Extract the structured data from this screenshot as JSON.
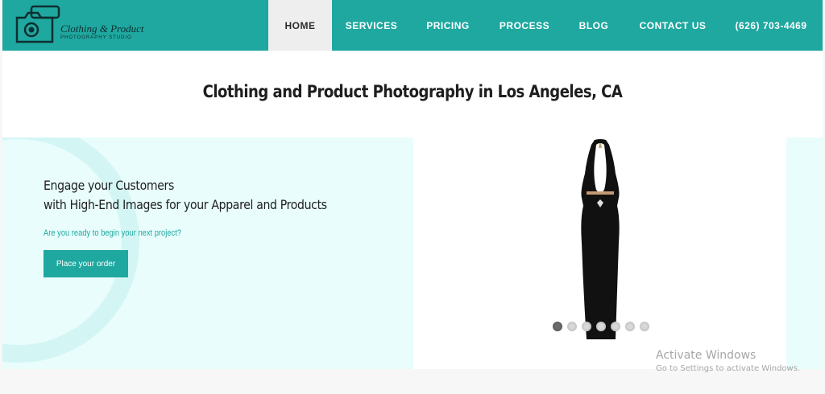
{
  "header": {
    "logo": {
      "title": "Clothing & Product",
      "subtitle": "Photography studio"
    },
    "nav": [
      {
        "label": "HOME",
        "active": true
      },
      {
        "label": "SERVICES",
        "active": false
      },
      {
        "label": "PRICING",
        "active": false
      },
      {
        "label": "PROCESS",
        "active": false
      },
      {
        "label": "BLOG",
        "active": false
      },
      {
        "label": "CONTACT US",
        "active": false
      },
      {
        "label": "(626) 703-4469",
        "active": false
      }
    ]
  },
  "main": {
    "title": "Clothing and Product Photography in Los Angeles, CA",
    "hero": {
      "headline_line1": "Engage your Customers",
      "headline_line2": "with High-End Images for your Apparel and Products",
      "prompt": "Are you ready to begin your next project?",
      "cta_label": "Place your order"
    },
    "slider": {
      "slide_count": 7,
      "active_index": 0
    }
  },
  "watermark": {
    "title": "Activate Windows",
    "subtitle": "Go to Settings to activate Windows."
  },
  "colors": {
    "brand": "#1fa8a0",
    "hero_bg": "#e8fdfc",
    "nav_active_bg": "#eeeeee"
  },
  "icons": {
    "logo": "camera-icon"
  }
}
